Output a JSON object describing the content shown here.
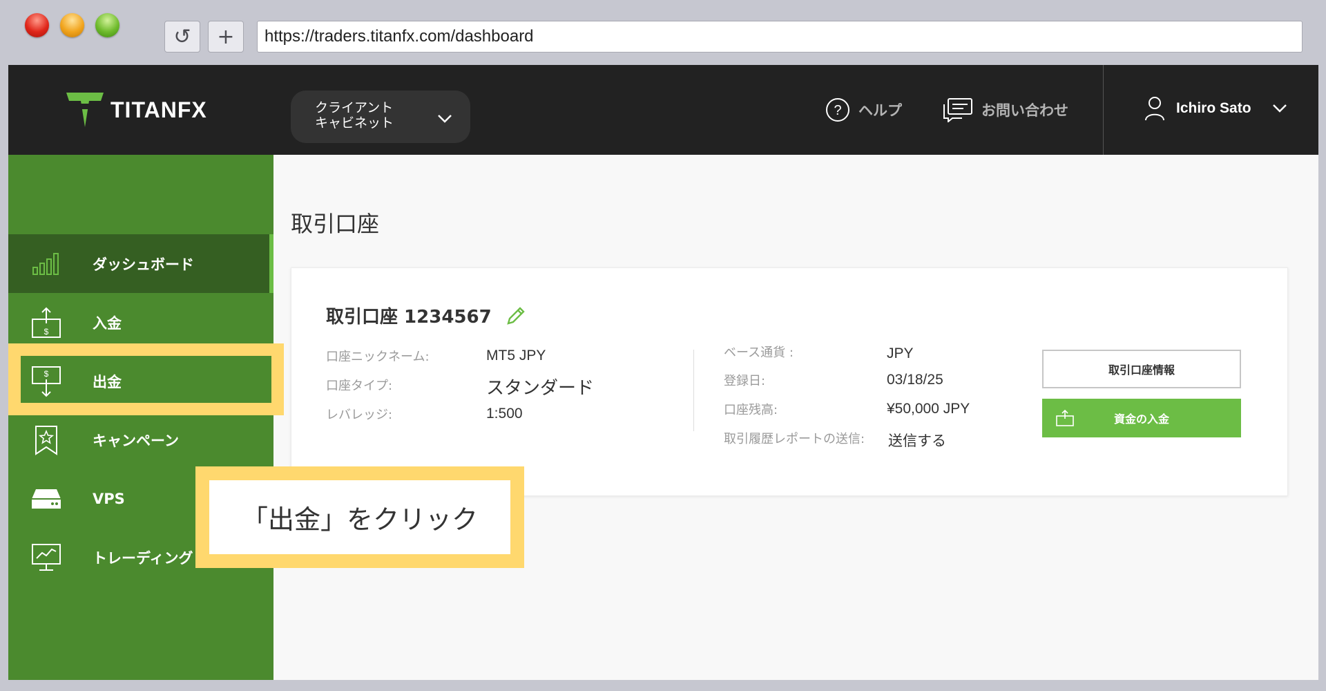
{
  "browser": {
    "url": "https://traders.titanfx.com/dashboard",
    "reload_glyph": "↺",
    "newtab_glyph": "+"
  },
  "header": {
    "logo_text": "TITANFX",
    "cabinet_label_line1": "クライアント",
    "cabinet_label_line2": "キャビネット",
    "help_label": "ヘルプ",
    "contact_label": "お問い合わせ",
    "user_name": "Ichiro Sato"
  },
  "sidebar": {
    "items": [
      {
        "label": "ダッシュボード",
        "icon": "bar-chart-icon",
        "active": true
      },
      {
        "label": "入金",
        "icon": "deposit-icon",
        "active": false
      },
      {
        "label": "出金",
        "icon": "withdraw-icon",
        "active": false
      },
      {
        "label": "キャンペーン",
        "icon": "ribbon-star-icon",
        "active": false
      },
      {
        "label": "VPS",
        "icon": "server-icon",
        "active": false
      },
      {
        "label": "トレーディング",
        "icon": "monitor-chart-icon",
        "active": false
      }
    ]
  },
  "main": {
    "title": "取引口座",
    "card": {
      "title": "取引口座 1234567",
      "left": [
        {
          "label": "口座ニックネーム:",
          "value": "MT5 JPY"
        },
        {
          "label": "口座タイプ:",
          "value": "スタンダード"
        },
        {
          "label": "レバレッジ:",
          "value": "1:500"
        }
      ],
      "right": [
        {
          "label": "ベース通貨 :",
          "value": "JPY"
        },
        {
          "label": "登録日:",
          "value": "03/18/25"
        },
        {
          "label": "口座残高:",
          "value": "¥50,000 JPY"
        },
        {
          "label": "取引履歴レポートの送信:",
          "value": "送信する"
        }
      ],
      "btn_info": "取引口座情報",
      "btn_deposit": "資金の入金"
    }
  },
  "callout": {
    "text": "「出金」をクリック"
  },
  "colors": {
    "sidebar": "#4b8a2e",
    "sidebar_active": "#355f22",
    "accent_green": "#6cbd45",
    "callout_yellow": "#ffd86e",
    "topbar": "#222222"
  }
}
